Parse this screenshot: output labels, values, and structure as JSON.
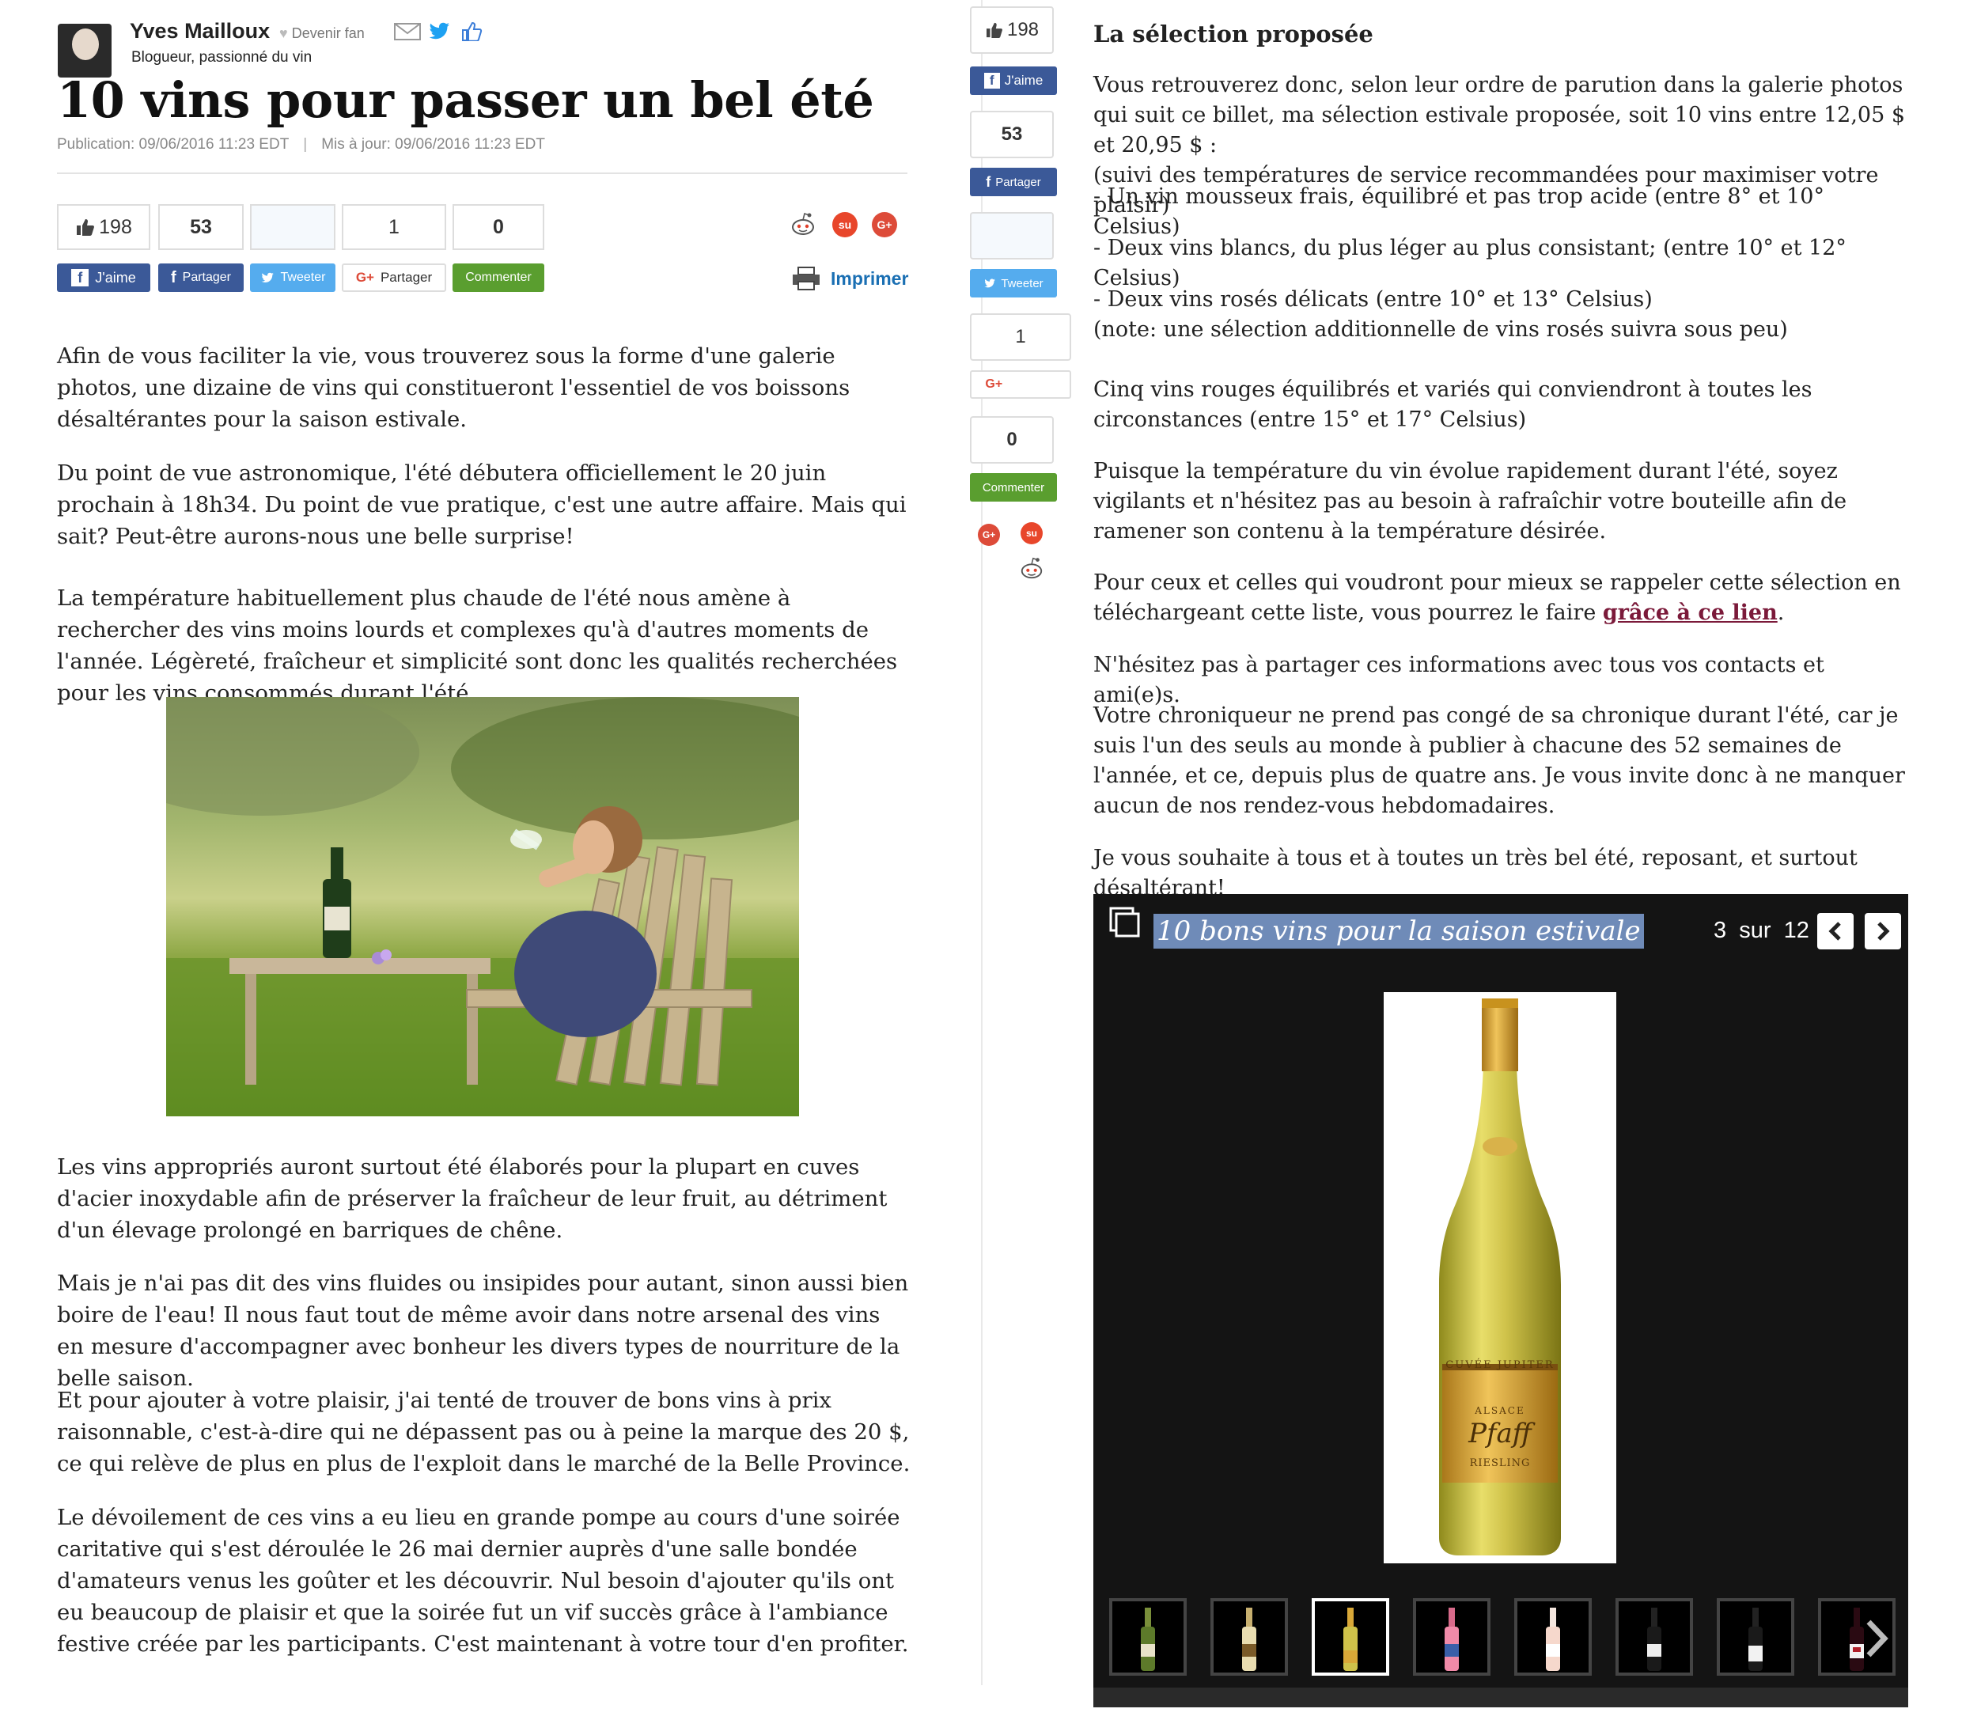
{
  "author": {
    "name": "Yves Mailloux",
    "fan_label": "Devenir fan",
    "role": "Blogueur, passionné du vin"
  },
  "article": {
    "title": "10 vins pour passer un bel été",
    "published": "Publication: 09/06/2016 11:23 EDT",
    "updated": "Mis à jour: 09/06/2016 11:23 EDT",
    "paragraphs_left": [
      "Afin de vous faciliter la vie, vous trouverez sous la forme d'une galerie photos, une dizaine de vins qui constitueront l'essentiel de vos boissons désaltérantes pour la saison estivale.",
      "Du point de vue astronomique, l'été débutera officiellement le 20 juin prochain à 18h34. Du point de vue pratique, c'est une autre affaire. Mais qui sait? Peut-être aurons-nous une belle surprise!",
      "La température habituellement plus chaude de l'été nous amène à rechercher des vins moins lourds et complexes qu'à d'autres moments de l'année. Légèreté, fraîcheur et simplicité sont donc les qualités recherchées pour les vins consommés durant l'été.",
      "Les vins appropriés auront surtout été élaborés pour la plupart en cuves d'acier inoxydable afin de préserver la fraîcheur de leur fruit, au détriment d'un élevage prolongé en barriques de chêne.",
      "Mais je n'ai pas dit des vins fluides ou insipides pour autant, sinon aussi bien boire de l'eau! Il nous faut tout de même avoir dans notre arsenal des vins en mesure d'accompagner avec bonheur les divers types de nourriture de la belle saison.",
      "Et pour ajouter à votre plaisir, j'ai tenté de trouver de bons vins à prix raisonnable, c'est-à-dire qui ne dépassent pas ou à peine la marque des 20 $, ce qui relève de plus en plus de l'exploit dans le marché de la Belle Province.",
      "Le dévoilement de ces vins a eu lieu en grande pompe au cours d'une soirée caritative qui s'est déroulée le 26 mai dernier auprès d'une salle bondée d'amateurs venus les goûter et les découvrir. Nul besoin d'ajouter qu'ils ont eu beaucoup de plaisir et que la soirée fut un vif succès grâce à l'ambiance festive créée par les participants. C'est maintenant à votre tour d'en profiter."
    ]
  },
  "share": {
    "like_count": "198",
    "fb_count": "53",
    "tw_count": "",
    "gp_count": "1",
    "comment_count": "0",
    "like_label": "J'aime",
    "fb_label": "Partager",
    "tw_label": "Tweeter",
    "gp_label": "Partager",
    "comment_label": "Commenter",
    "print_label": "Imprimer"
  },
  "selection": {
    "title": "La sélection proposée",
    "p1": "Vous retrouverez donc, selon leur ordre de parution dans la galerie photos qui suit ce billet, ma sélection estivale proposée, soit 10 vins entre 12,05 $ et 20,95 $ :",
    "p1b": "(suivi des températures de service recommandées pour maximiser votre plaisir)",
    "p2": "- Un vin mousseux frais, équilibré et pas trop acide (entre 8° et 10° Celsius)",
    "p3": "- Deux vins blancs, du plus léger au plus consistant; (entre 10° et 12° Celsius)",
    "p4": "- Deux vins rosés délicats (entre 10° et 13° Celsius)",
    "p4b": "(note: une sélection additionnelle de vins rosés suivra sous peu)",
    "p5": "Cinq vins rouges équilibrés et variés qui conviendront à toutes les circonstances (entre 15° et 17° Celsius)",
    "p6": "Puisque la température du vin évolue rapidement durant l'été, soyez vigilants et n'hésitez pas au besoin à rafraîchir votre bouteille afin de ramener son contenu à la température désirée.",
    "p7_before": "Pour ceux et celles qui voudront pour mieux se rappeler cette sélection en téléchargeant cette liste, vous pourrez le faire ",
    "p7_link": "grâce à ce lien",
    "p7_after": ".",
    "p8": "N'hésitez pas à partager ces informations avec tous vos contacts et ami(e)s.",
    "p9": "Votre chroniqueur ne prend pas congé de sa chronique durant l'été, car je suis l'un des seuls au monde à publier à chacune des 52 semaines de l'année, et ce, depuis plus de quatre ans. Je vous invite donc à ne manquer aucun de nos rendez-vous hebdomadaires.",
    "p10": "Je vous souhaite à tous et à toutes un très bel été, reposant, et surtout désaltérant!"
  },
  "gallery": {
    "title": "10 bons vins pour la saison estivale",
    "current": "3",
    "of_label": "sur",
    "total": "12",
    "label_cuvee": "CUVÉE JUPITER",
    "label_region": "ALSACE",
    "label_brand": "Pfaff",
    "label_variety": "RIESLING"
  },
  "colors": {
    "facebook": "#3b5998",
    "twitter": "#55acee",
    "comment": "#5a9e2f",
    "link": "#7b1a3a",
    "print": "#1a6fb3"
  }
}
